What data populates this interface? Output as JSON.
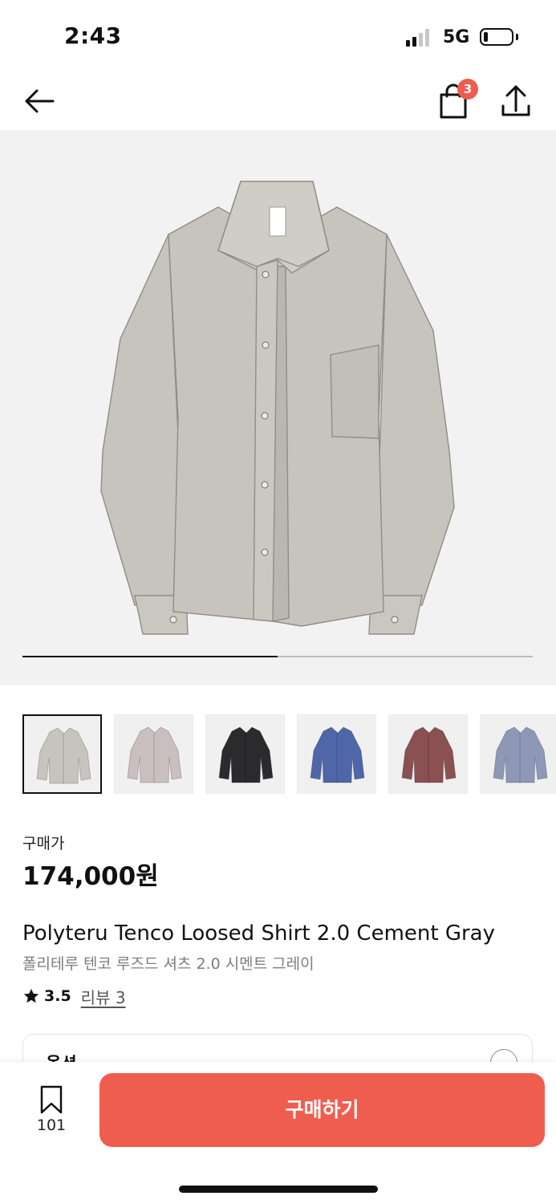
{
  "status_bar": {
    "time": "2:43",
    "network": "5G",
    "battery_level": 0.15
  },
  "nav": {
    "back_icon": "arrow-left-icon",
    "cart_icon": "shopping-bag-icon",
    "cart_badge": "3",
    "share_icon": "share-icon"
  },
  "gallery": {
    "progress": 0.5,
    "thumbnails": [
      {
        "color": "#c6c4bd",
        "selected": true
      },
      {
        "color": "#c9bfbf",
        "selected": false
      },
      {
        "color": "#2b2b2d",
        "selected": false
      },
      {
        "color": "#4f66a8",
        "selected": false
      },
      {
        "color": "#8a5052",
        "selected": false
      },
      {
        "color": "#8e97b5",
        "selected": false
      }
    ]
  },
  "product": {
    "price_label": "구매가",
    "price": "174,000원",
    "title_en": "Polyteru Tenco Loosed Shirt 2.0 Cement Gray",
    "title_ko": "폴리테루 텐코 루즈드 셔츠 2.0 시멘트 그레이",
    "rating": "3.5",
    "review_link": "리뷰 3",
    "option_label": "옵션"
  },
  "bottom_bar": {
    "bookmark_icon": "bookmark-icon",
    "bookmark_count": "101",
    "buy_label": "구매하기"
  },
  "colors": {
    "accent": "#ef5d4f",
    "text": "#111111",
    "muted": "#7d7d7d"
  }
}
